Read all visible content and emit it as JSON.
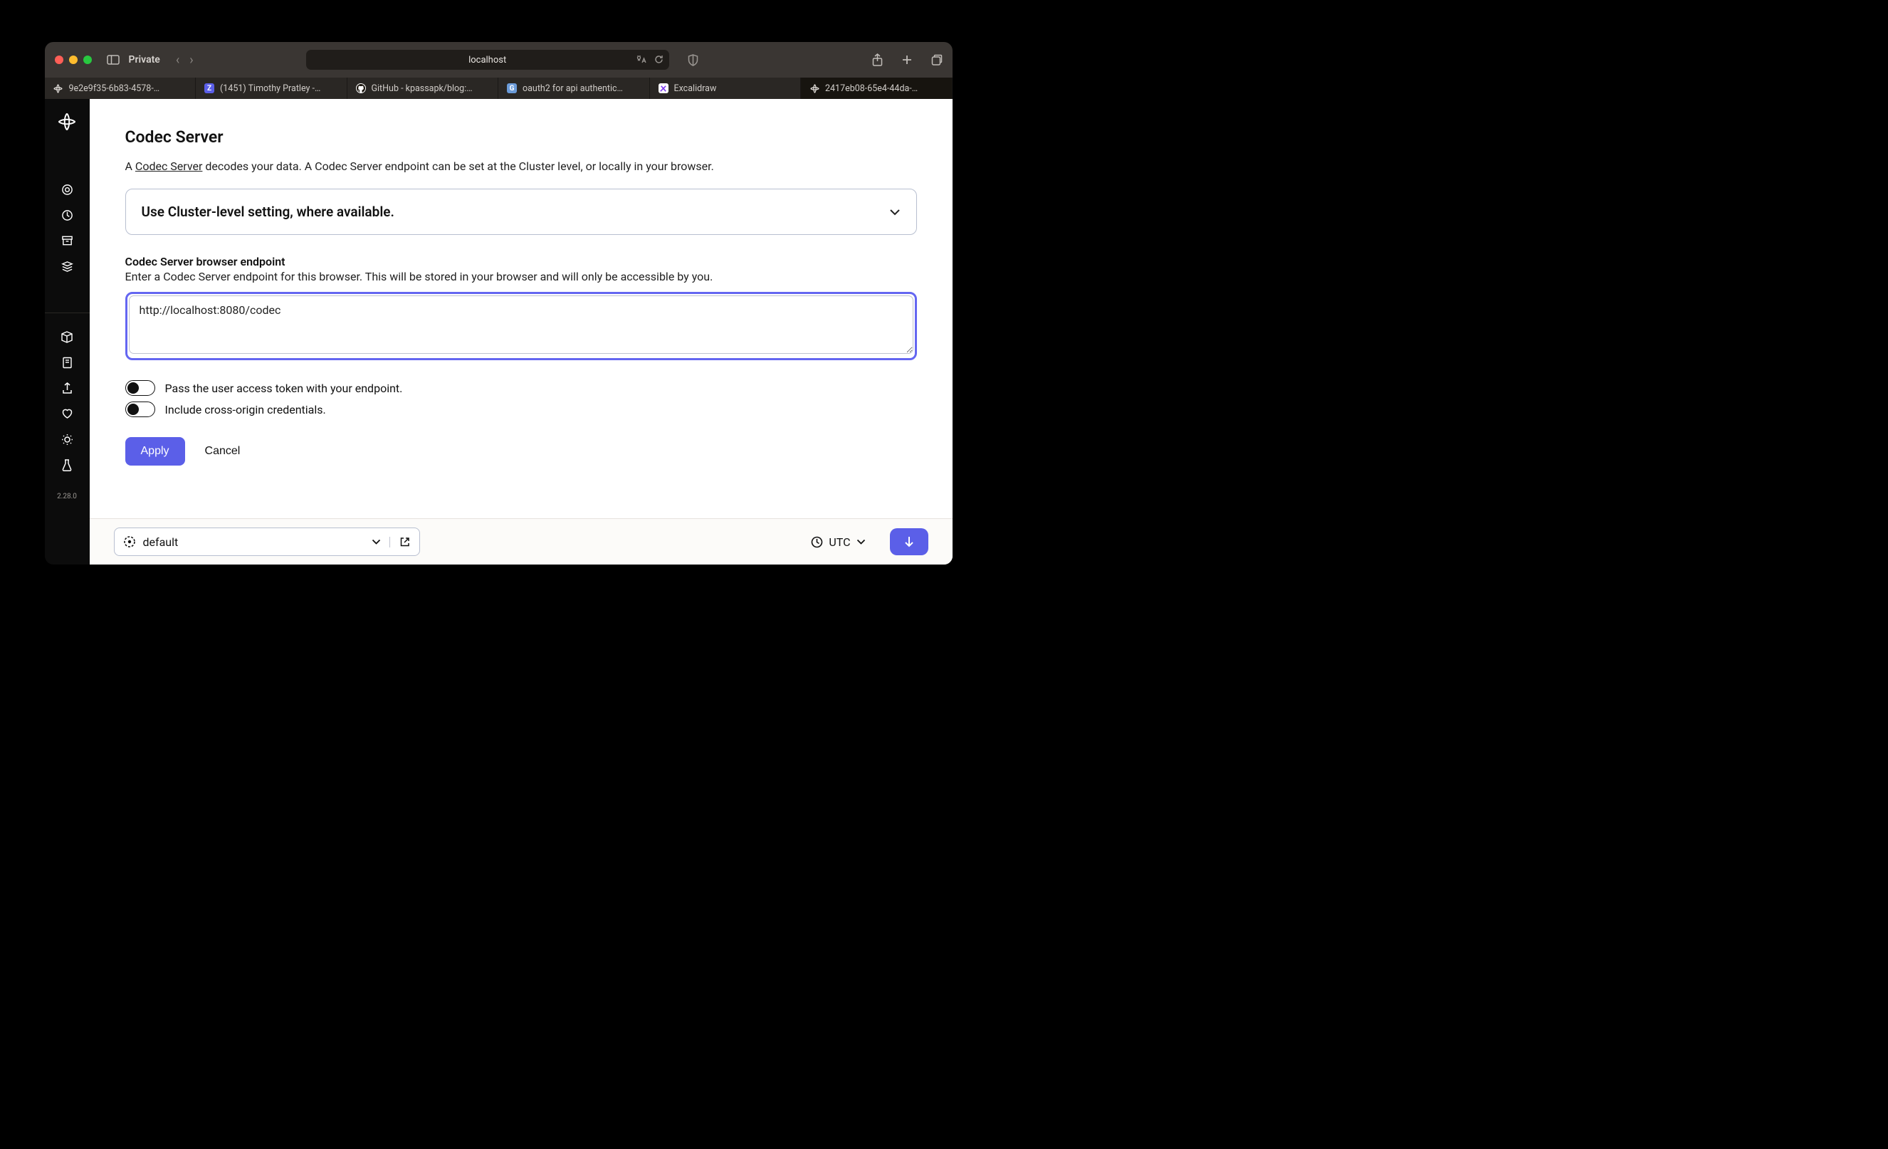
{
  "toolbar": {
    "private_label": "Private",
    "address": "localhost"
  },
  "tabs": [
    {
      "label": "9e2e9f35-6b83-4578-…"
    },
    {
      "label": "(1451) Timothy Pratley -…"
    },
    {
      "label": "GitHub - kpassapk/blog:…"
    },
    {
      "label": "oauth2 for api authentic…"
    },
    {
      "label": "Excalidraw"
    },
    {
      "label": "2417eb08-65e4-44da-…"
    }
  ],
  "sidebar": {
    "version": "2.28.0"
  },
  "page": {
    "title": "Codec Server",
    "intro_prefix": "A ",
    "intro_link": "Codec Server",
    "intro_suffix": " decodes your data. A Codec Server endpoint can be set at the Cluster level, or locally in your browser.",
    "dropdown_label": "Use Cluster-level setting, where available.",
    "endpoint_label": "Codec Server browser endpoint",
    "endpoint_help": "Enter a Codec Server endpoint for this browser. This will be stored in your browser and will only be accessible by you.",
    "endpoint_value": "http://localhost:8080/codec",
    "toggle_token_label": "Pass the user access token with your endpoint.",
    "toggle_cors_label": "Include cross-origin credentials.",
    "apply_label": "Apply",
    "cancel_label": "Cancel"
  },
  "footer": {
    "namespace": "default",
    "timezone": "UTC"
  }
}
